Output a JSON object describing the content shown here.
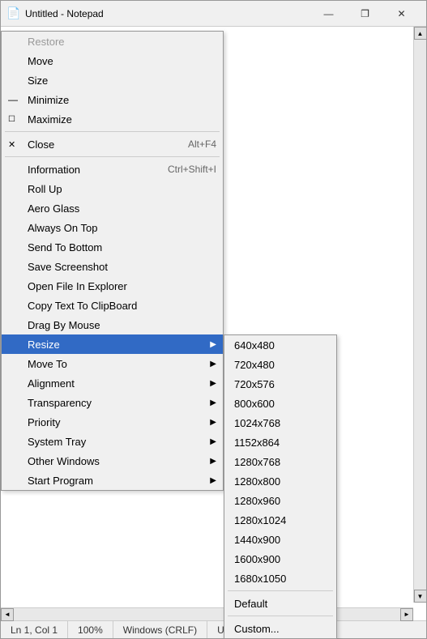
{
  "titlebar": {
    "icon": "📄",
    "title": "Untitled - Notepad",
    "minimize_label": "—",
    "restore_label": "❐",
    "close_label": "✕"
  },
  "statusbar": {
    "position": "Ln 1, Col 1",
    "zoom": "100%",
    "line_ending": "Windows (CRLF)",
    "encoding": "UTF-8"
  },
  "context_menu": {
    "items": [
      {
        "label": "Restore",
        "disabled": true,
        "icon": ""
      },
      {
        "label": "Move",
        "disabled": false
      },
      {
        "label": "Size",
        "disabled": false
      },
      {
        "label": "Minimize",
        "disabled": false,
        "icon": "—"
      },
      {
        "label": "Maximize",
        "disabled": false,
        "icon": "❐"
      },
      {
        "label": "Close",
        "shortcut": "Alt+F4",
        "disabled": false,
        "icon": "✕",
        "separator_above": true
      },
      {
        "label": "Information",
        "shortcut": "Ctrl+Shift+I",
        "separator_above": true
      },
      {
        "label": "Roll Up"
      },
      {
        "label": "Aero Glass"
      },
      {
        "label": "Always On Top"
      },
      {
        "label": "Send To Bottom"
      },
      {
        "label": "Save Screenshot"
      },
      {
        "label": "Open File In Explorer"
      },
      {
        "label": "Copy Text To ClipBoard"
      },
      {
        "label": "Drag By Mouse"
      },
      {
        "label": "Resize",
        "has_arrow": true,
        "highlighted": true
      },
      {
        "label": "Move To",
        "has_arrow": true
      },
      {
        "label": "Alignment",
        "has_arrow": true
      },
      {
        "label": "Transparency",
        "has_arrow": true
      },
      {
        "label": "Priority",
        "has_arrow": true
      },
      {
        "label": "System Tray",
        "has_arrow": true
      },
      {
        "label": "Other Windows",
        "has_arrow": true
      },
      {
        "label": "Start Program",
        "has_arrow": true
      }
    ]
  },
  "submenu": {
    "items": [
      {
        "label": "640x480"
      },
      {
        "label": "720x480"
      },
      {
        "label": "720x576"
      },
      {
        "label": "800x600"
      },
      {
        "label": "1024x768"
      },
      {
        "label": "1152x864"
      },
      {
        "label": "1280x768"
      },
      {
        "label": "1280x800"
      },
      {
        "label": "1280x960"
      },
      {
        "label": "1280x1024"
      },
      {
        "label": "1440x900"
      },
      {
        "label": "1600x900"
      },
      {
        "label": "1680x1050"
      },
      {
        "label": "Default",
        "separator_above": true
      },
      {
        "label": "Custom...",
        "separator_above": false
      }
    ]
  }
}
